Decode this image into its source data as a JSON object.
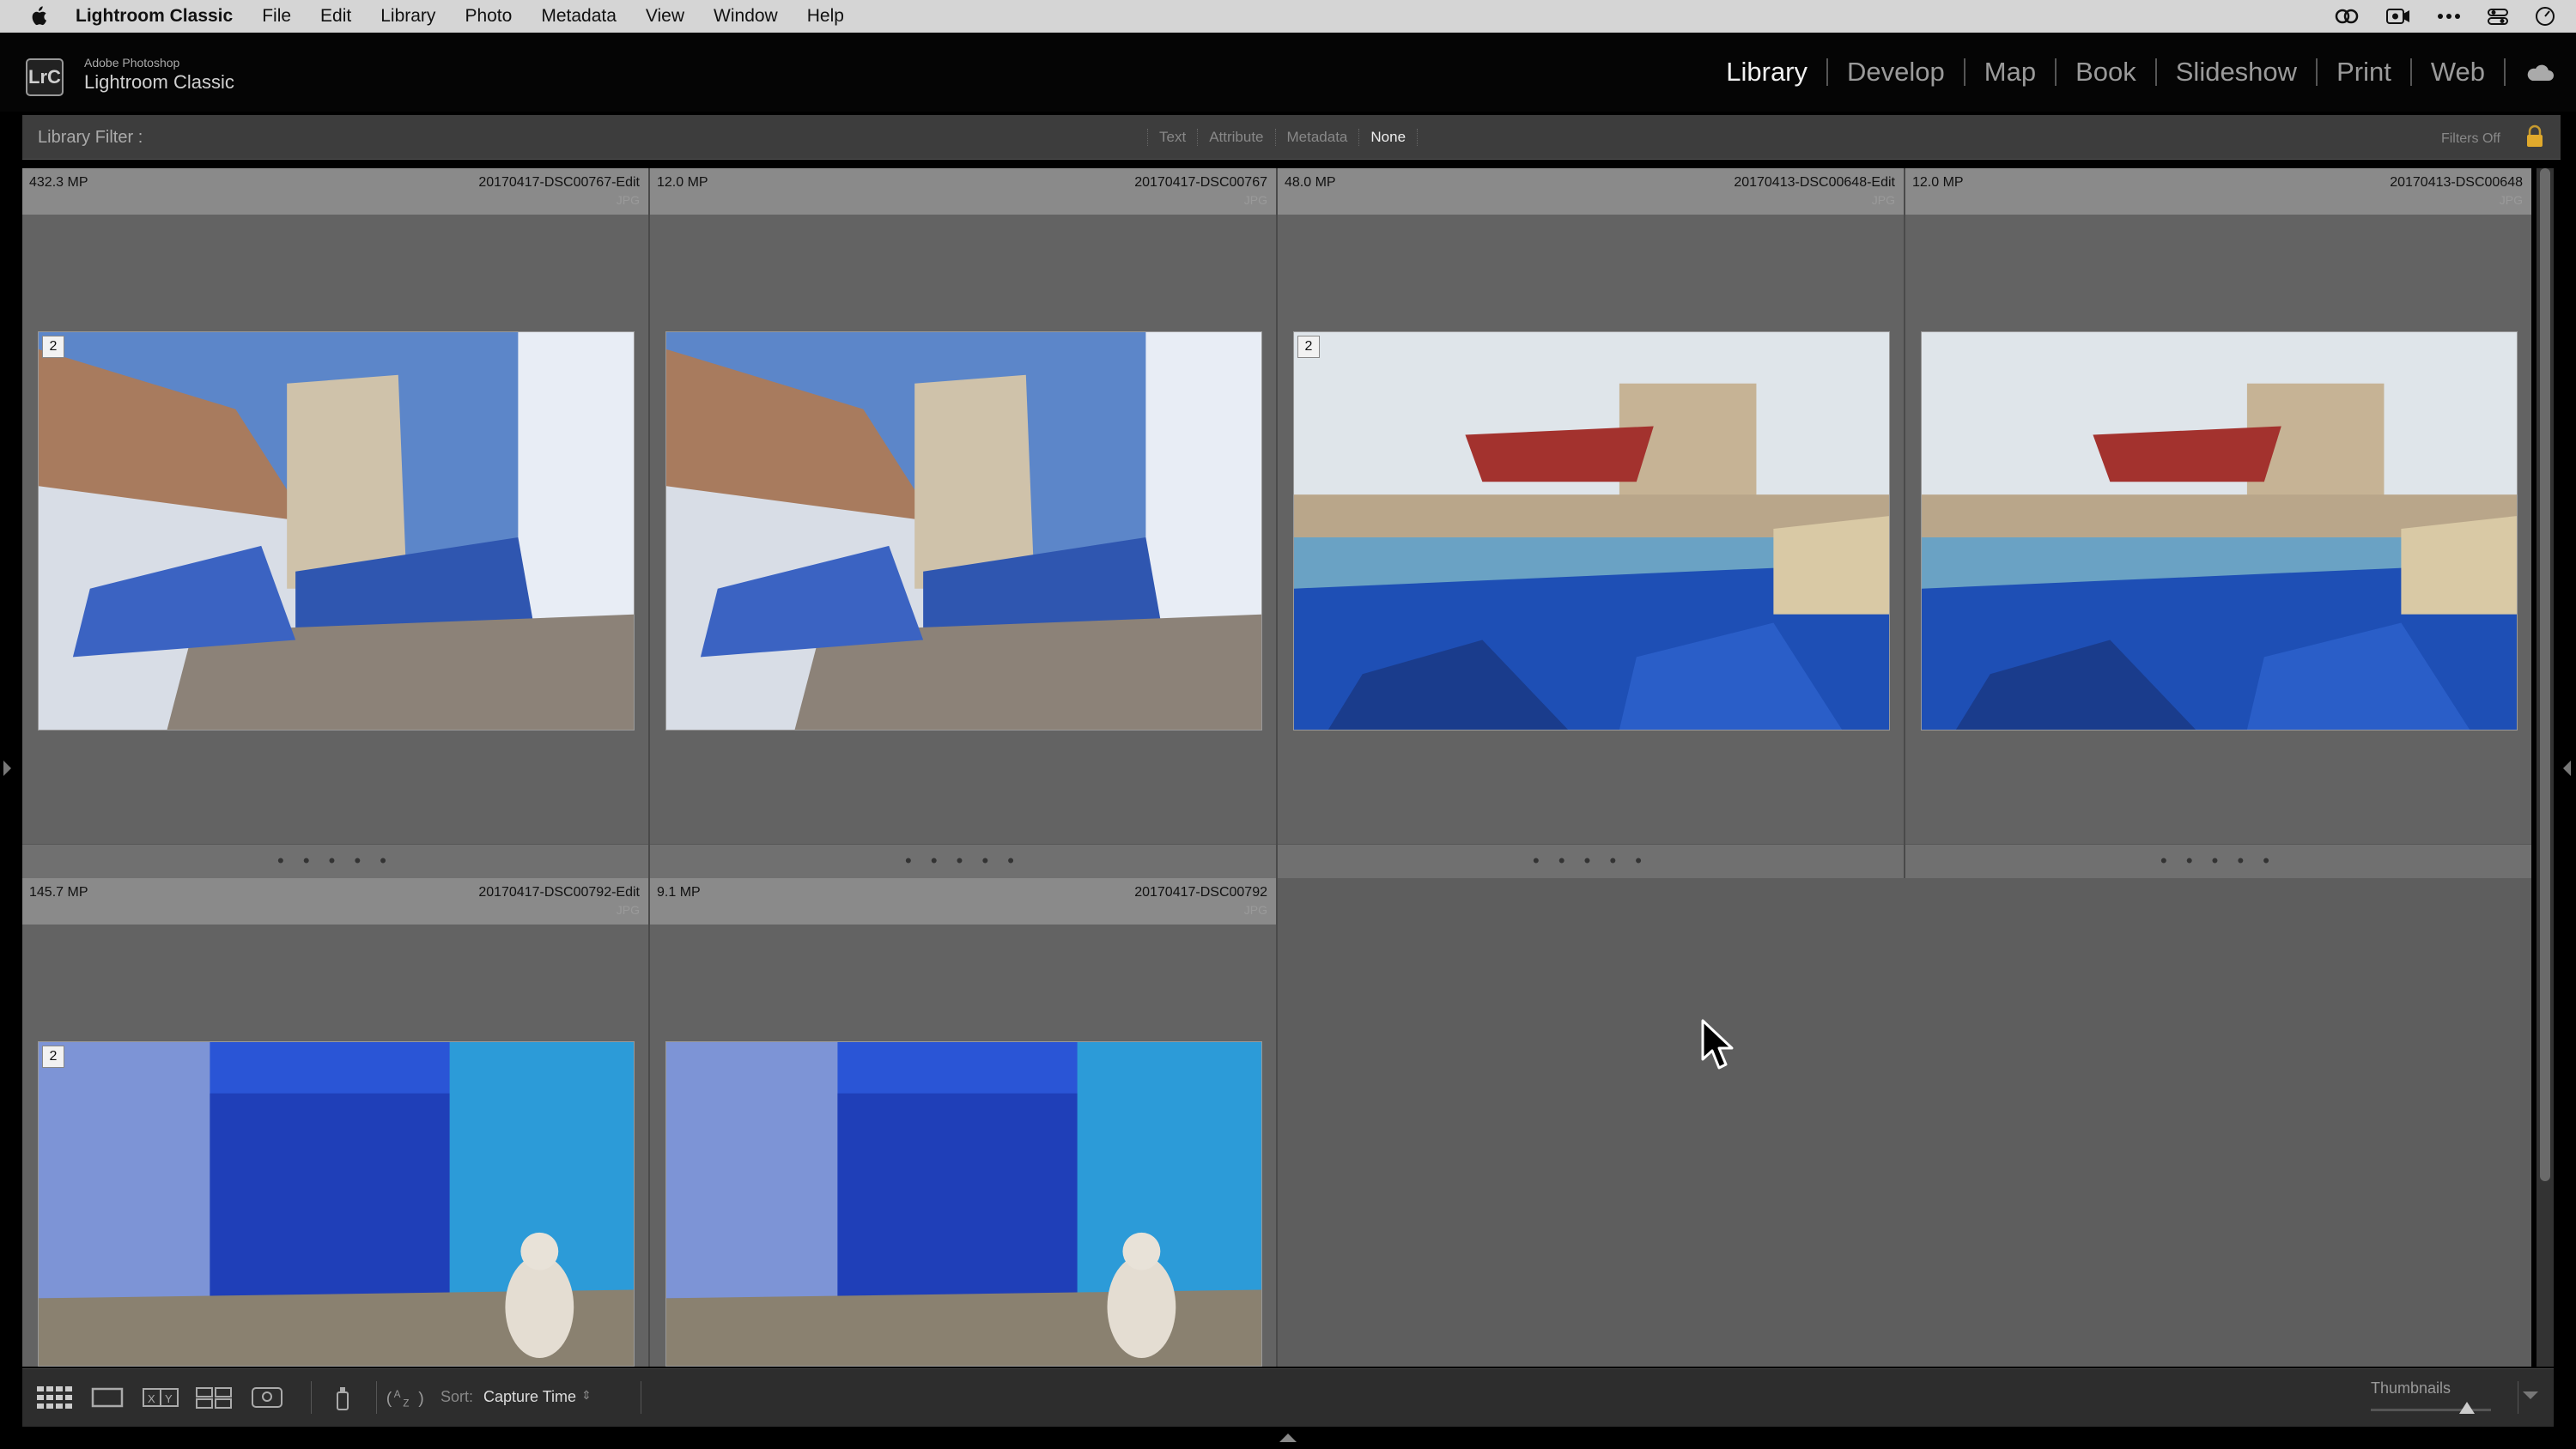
{
  "menubar": {
    "app_name": "Lightroom Classic",
    "items": [
      "File",
      "Edit",
      "Library",
      "Photo",
      "Metadata",
      "View",
      "Window",
      "Help"
    ],
    "status_icons": [
      "creative-cloud-icon",
      "screen-record-icon",
      "more-icon",
      "control-center-icon",
      "clock-icon"
    ]
  },
  "identity": {
    "logo": "LrC",
    "line1": "Adobe Photoshop",
    "line2": "Lightroom Classic"
  },
  "modules": {
    "items": [
      "Library",
      "Develop",
      "Map",
      "Book",
      "Slideshow",
      "Print",
      "Web"
    ],
    "active": "Library"
  },
  "filter": {
    "label": "Library Filter :",
    "options": [
      "Text",
      "Attribute",
      "Metadata",
      "None"
    ],
    "selected": "None",
    "status": "Filters Off"
  },
  "photos": [
    {
      "mp": "432.3 MP",
      "name": "20170417-DSC00767-Edit",
      "ext": "JPG",
      "stack": "2",
      "scene": "stairs"
    },
    {
      "mp": "12.0 MP",
      "name": "20170417-DSC00767",
      "ext": "JPG",
      "stack": "",
      "scene": "stairs"
    },
    {
      "mp": "48.0 MP",
      "name": "20170413-DSC00648-Edit",
      "ext": "JPG",
      "stack": "2",
      "scene": "harbor"
    },
    {
      "mp": "12.0 MP",
      "name": "20170413-DSC00648",
      "ext": "JPG",
      "stack": "",
      "scene": "harbor"
    },
    {
      "mp": "145.7 MP",
      "name": "20170417-DSC00792-Edit",
      "ext": "JPG",
      "stack": "2",
      "scene": "cat"
    },
    {
      "mp": "9.1 MP",
      "name": "20170417-DSC00792",
      "ext": "JPG",
      "stack": "",
      "scene": "cat"
    }
  ],
  "rating_dots": "• • • • •",
  "toolbar": {
    "view_buttons": [
      "grid-view-icon",
      "loupe-view-icon",
      "compare-view-icon",
      "survey-view-icon",
      "people-view-icon"
    ],
    "sort_label": "Sort:",
    "sort_value": "Capture Time",
    "thumbnails_label": "Thumbnails",
    "thumbnail_size": 0.8
  },
  "colors": {
    "grid_bg": "#5e5e5e",
    "cell_header": "#8a8a8a",
    "accent_blue": "#1f5fc8"
  }
}
